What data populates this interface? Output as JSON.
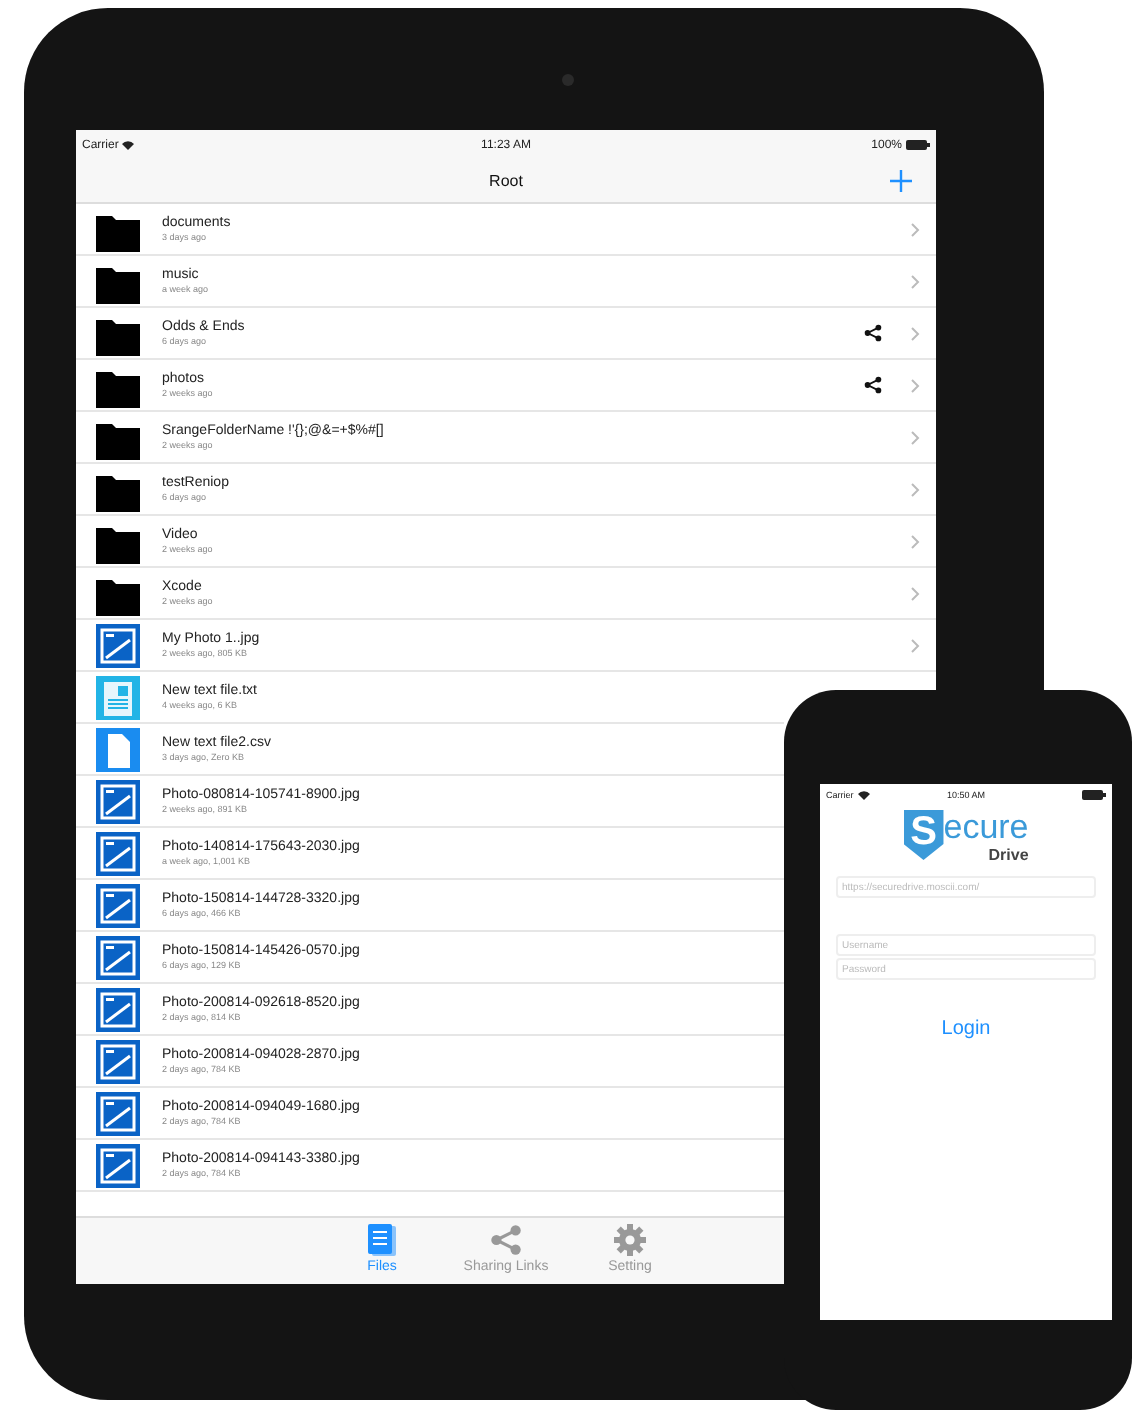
{
  "tablet": {
    "status_bar": {
      "carrier": "Carrier",
      "time": "11:23 AM",
      "battery": "100%"
    },
    "nav": {
      "title": "Root"
    },
    "rows": [
      {
        "kind": "folder",
        "name": "documents",
        "detail": "3 days ago",
        "shared": false,
        "chevron": true
      },
      {
        "kind": "folder",
        "name": "music",
        "detail": "a week ago",
        "shared": false,
        "chevron": true
      },
      {
        "kind": "folder",
        "name": "Odds & Ends",
        "detail": "6 days ago",
        "shared": true,
        "chevron": true
      },
      {
        "kind": "folder",
        "name": "photos",
        "detail": "2 weeks ago",
        "shared": true,
        "chevron": true
      },
      {
        "kind": "folder",
        "name": "SrangeFolderName !'{};@&=+$%#[]",
        "detail": "2 weeks ago",
        "shared": false,
        "chevron": true
      },
      {
        "kind": "folder",
        "name": "testReniop",
        "detail": "6 days ago",
        "shared": false,
        "chevron": true
      },
      {
        "kind": "folder",
        "name": "Video",
        "detail": "2 weeks ago",
        "shared": false,
        "chevron": true
      },
      {
        "kind": "folder",
        "name": "Xcode",
        "detail": "2 weeks ago",
        "shared": false,
        "chevron": true
      },
      {
        "kind": "image",
        "name": "My Photo 1..jpg",
        "detail": "2 weeks ago, 805 KB",
        "shared": false,
        "chevron": true
      },
      {
        "kind": "text",
        "name": "New text file.txt",
        "detail": "4 weeks ago, 6 KB",
        "shared": false,
        "chevron": false
      },
      {
        "kind": "document",
        "name": "New text file2.csv",
        "detail": "3 days ago, Zero KB",
        "shared": false,
        "chevron": false
      },
      {
        "kind": "image",
        "name": "Photo-080814-105741-8900.jpg",
        "detail": "2 weeks ago, 891 KB",
        "shared": false,
        "chevron": false
      },
      {
        "kind": "image",
        "name": "Photo-140814-175643-2030.jpg",
        "detail": "a week ago, 1,001 KB",
        "shared": false,
        "chevron": false
      },
      {
        "kind": "image",
        "name": "Photo-150814-144728-3320.jpg",
        "detail": "6 days ago, 466 KB",
        "shared": false,
        "chevron": false
      },
      {
        "kind": "image",
        "name": "Photo-150814-145426-0570.jpg",
        "detail": "6 days ago, 129 KB",
        "shared": false,
        "chevron": false
      },
      {
        "kind": "image",
        "name": "Photo-200814-092618-8520.jpg",
        "detail": "2 days ago, 814 KB",
        "shared": false,
        "chevron": false
      },
      {
        "kind": "image",
        "name": "Photo-200814-094028-2870.jpg",
        "detail": "2 days ago, 784 KB",
        "shared": false,
        "chevron": false
      },
      {
        "kind": "image",
        "name": "Photo-200814-094049-1680.jpg",
        "detail": "2 days ago, 784 KB",
        "shared": false,
        "chevron": false
      },
      {
        "kind": "image",
        "name": "Photo-200814-094143-3380.jpg",
        "detail": "2 days ago, 784 KB",
        "shared": false,
        "chevron": false
      }
    ],
    "tabs": [
      {
        "kind": "files",
        "label": "Files",
        "selected": true
      },
      {
        "kind": "share",
        "label": "Sharing Links",
        "selected": false
      },
      {
        "kind": "gear",
        "label": "Setting",
        "selected": false
      }
    ]
  },
  "phone": {
    "status_bar": {
      "carrier": "Carrier",
      "time": "10:50 AM"
    },
    "logo": {
      "initial": "S",
      "word": "ecure",
      "sub": "Drive"
    },
    "server_field": {
      "placeholder": "https://securedrive.moscii.com/"
    },
    "credential_fields": [
      {
        "placeholder": "Username"
      },
      {
        "placeholder": "Password"
      }
    ],
    "login": "Login"
  }
}
